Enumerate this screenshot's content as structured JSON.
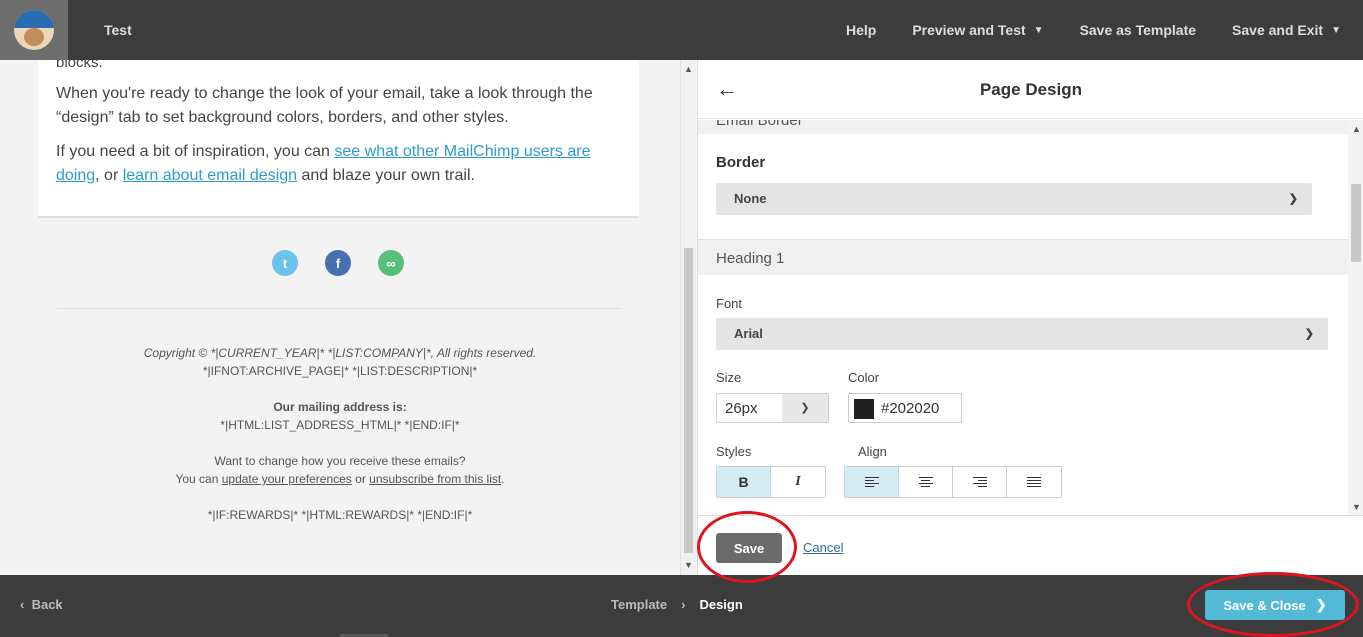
{
  "topbar": {
    "title": "Test",
    "nav": [
      {
        "label": "Help",
        "chevron": false
      },
      {
        "label": "Preview and Test",
        "chevron": true
      },
      {
        "label": "Save as Template",
        "chevron": false
      },
      {
        "label": "Save and Exit",
        "chevron": true
      }
    ]
  },
  "preview": {
    "cut_text": "blocks.",
    "para1": "When you're ready to change the look of your email, take a look through the “design” tab to set background colors, borders, and other styles.",
    "para2_prefix": "If you need a bit of inspiration, you can ",
    "para2_link1": "see what other MailChimp users are doing",
    "para2_mid": ", or ",
    "para2_link2": "learn about email design",
    "para2_suffix": " and blaze your own trail.",
    "social": [
      "twitter-icon",
      "facebook-icon",
      "link-icon"
    ],
    "footer": {
      "copyright": "Copyright © *|CURRENT_YEAR|* *|LIST:COMPANY|*, All rights reserved.",
      "archive": "*|IFNOT:ARCHIVE_PAGE|* *|LIST:DESCRIPTION|*",
      "address_label": "Our mailing address is:",
      "address": "*|HTML:LIST_ADDRESS_HTML|* *|END:IF|*",
      "change_text": "Want to change how you receive these emails?",
      "can_prefix": "You can ",
      "update_link": "update your preferences",
      "or_text": " or ",
      "unsub_link": "unsubscribe from this list",
      "period": ".",
      "rewards": "*|IF:REWARDS|* *|HTML:REWARDS|* *|END:IF|*"
    }
  },
  "panel": {
    "title": "Page Design",
    "section_cut": "Email Border",
    "border_label": "Border",
    "border_value": "None",
    "heading_section": "Heading 1",
    "font_label": "Font",
    "font_value": "Arial",
    "size_label": "Size",
    "size_value": "26px",
    "color_label": "Color",
    "color_value": "#202020",
    "styles_label": "Styles",
    "bold_label": "B",
    "italic_label": "I",
    "align_label": "Align",
    "save_label": "Save",
    "cancel_label": "Cancel"
  },
  "bottombar": {
    "back_label": "Back",
    "crumbs": [
      "Template",
      "Design"
    ],
    "save_close_label": "Save & Close"
  },
  "colors": {
    "accent": "#52bad5",
    "link": "#2d9bcb",
    "annotation": "#e0141e"
  }
}
